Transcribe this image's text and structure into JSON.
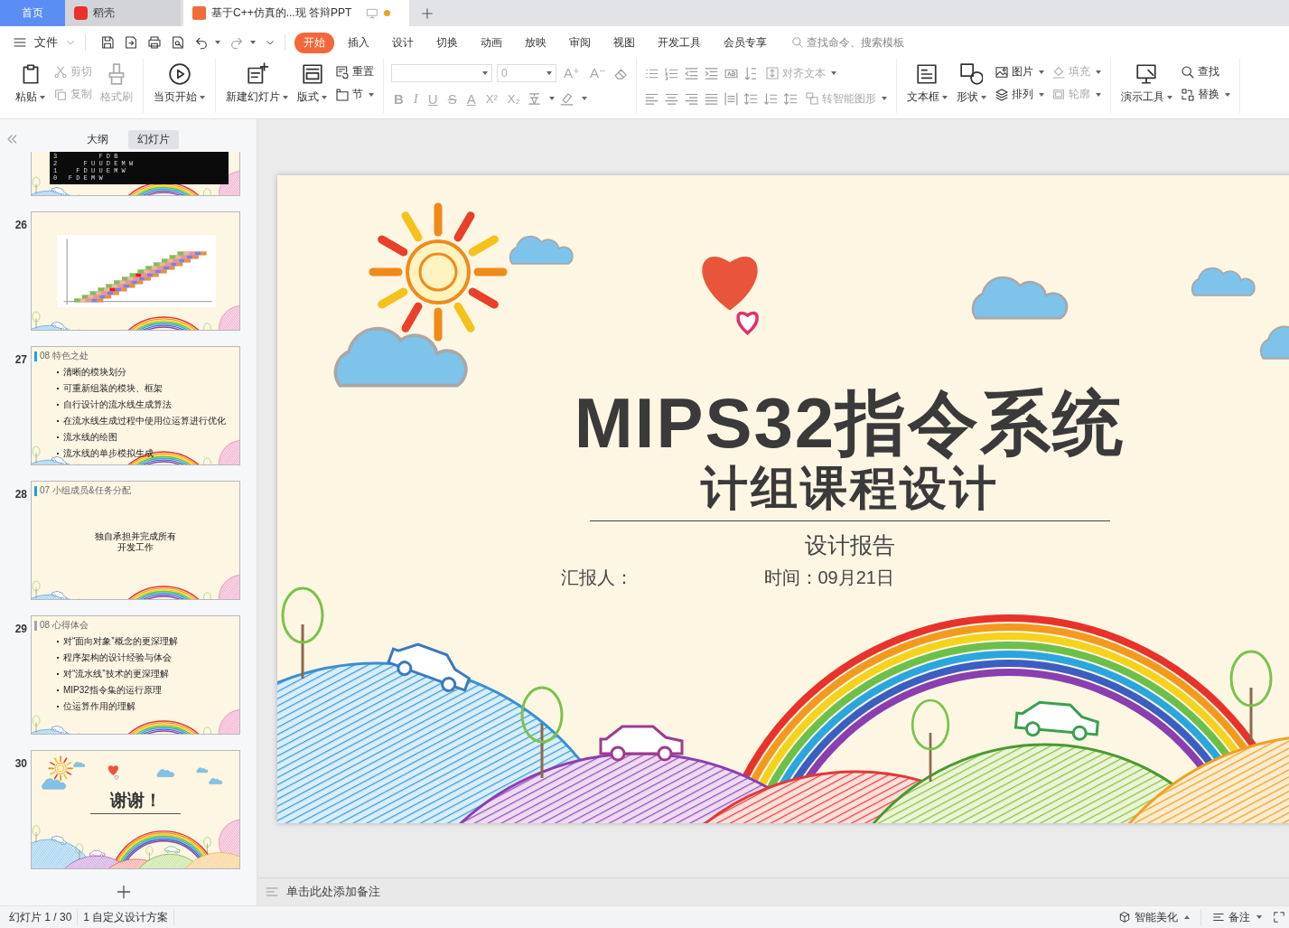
{
  "tabs": [
    {
      "label": "首页",
      "kind": "home",
      "selected": false
    },
    {
      "label": "稻壳",
      "kind": "app",
      "selected": false
    },
    {
      "label": "基于C++仿真的...现  答辩PPT",
      "kind": "doc",
      "selected": true
    }
  ],
  "menu": {
    "file": "文件",
    "ribbon_tabs": [
      {
        "label": "开始",
        "selected": true
      },
      {
        "label": "插入",
        "selected": false
      },
      {
        "label": "设计",
        "selected": false
      },
      {
        "label": "切换",
        "selected": false
      },
      {
        "label": "动画",
        "selected": false
      },
      {
        "label": "放映",
        "selected": false
      },
      {
        "label": "审阅",
        "selected": false
      },
      {
        "label": "视图",
        "selected": false
      },
      {
        "label": "开发工具",
        "selected": false
      },
      {
        "label": "会员专享",
        "selected": false
      }
    ],
    "search": {
      "placeholder": "查找命令、搜索模板"
    }
  },
  "ribbon": {
    "groups": [
      {
        "columns": [
          {
            "kind": "big",
            "label": "粘贴",
            "dropdown": true,
            "disabled": false
          },
          {
            "kind": "stack",
            "items": [
              {
                "label": "剪切",
                "dropdown": false,
                "disabled": true
              },
              {
                "label": "复制",
                "dropdown": false,
                "disabled": true
              }
            ]
          },
          {
            "kind": "big",
            "label": "格式刷",
            "dropdown": false,
            "disabled": true
          }
        ]
      },
      {
        "columns": [
          {
            "kind": "big",
            "label": "当页开始",
            "dropdown": true,
            "disabled": false
          }
        ]
      },
      {
        "columns": [
          {
            "kind": "big",
            "label": "新建幻灯片",
            "dropdown": true,
            "disabled": false
          },
          {
            "kind": "big",
            "label": "版式",
            "dropdown": true,
            "disabled": false
          },
          {
            "kind": "stack",
            "items": [
              {
                "label": "重置",
                "dropdown": false,
                "disabled": false
              },
              {
                "label": "节",
                "dropdown": true,
                "disabled": false
              }
            ]
          }
        ]
      },
      {
        "columns": [
          {
            "kind": "font",
            "size": "0",
            "size_buttons": [
              "A⁺",
              "A⁻"
            ],
            "format_buttons": [
              "B",
              "I",
              "U",
              "S",
              "A",
              "X²",
              "X₂"
            ]
          }
        ]
      },
      {
        "columns": [
          {
            "kind": "paragraph",
            "items": [
              {
                "label": "对齐文本",
                "dropdown": true,
                "disabled": true
              },
              {
                "label": "转智能图形",
                "dropdown": true,
                "disabled": true
              }
            ]
          }
        ]
      },
      {
        "columns": [
          {
            "kind": "big",
            "label": "文本框",
            "dropdown": true,
            "disabled": false
          },
          {
            "kind": "big",
            "label": "形状",
            "dropdown": true,
            "disabled": false
          },
          {
            "kind": "stack",
            "items": [
              {
                "label": "图片",
                "dropdown": true,
                "disabled": false
              },
              {
                "label": "排列",
                "dropdown": true,
                "disabled": false
              }
            ]
          },
          {
            "kind": "stack",
            "items": [
              {
                "label": "填充",
                "dropdown": true,
                "disabled": true
              },
              {
                "label": "轮廓",
                "dropdown": true,
                "disabled": true
              }
            ]
          }
        ]
      },
      {
        "columns": [
          {
            "kind": "big",
            "label": "演示工具",
            "dropdown": true,
            "disabled": false
          },
          {
            "kind": "stack",
            "items": [
              {
                "label": "查找",
                "dropdown": false,
                "disabled": false
              },
              {
                "label": "替换",
                "dropdown": true,
                "disabled": false
              }
            ]
          }
        ]
      }
    ]
  },
  "sidebar": {
    "view_tabs": [
      {
        "label": "大纲",
        "selected": false
      },
      {
        "label": "幻灯片",
        "selected": true
      }
    ],
    "slides": [
      {
        "kind": "console",
        "lines": [
          "3           F D B",
          "2       F U U D E M W",
          "1     F D U U E M W",
          "0   F D E M W"
        ]
      },
      {
        "number": "26",
        "kind": "chart"
      },
      {
        "number": "27",
        "kind": "bullets",
        "heading": "08 特色之处",
        "color": "#1aa3e8",
        "bullets": [
          "清晰的模块划分",
          "可重新组装的模块、框架",
          "自行设计的流水线生成算法",
          "在流水线生成过程中使用位运算进行优化",
          "流水线的绘图",
          "流水线的单步模拟生成"
        ]
      },
      {
        "number": "28",
        "kind": "text",
        "heading": "07 小组成员&任务分配",
        "color": "#1aa3e8",
        "lines": [
          "独自承担并完成所有",
          "开发工作"
        ]
      },
      {
        "number": "29",
        "kind": "bullets",
        "heading": "08 心得体会",
        "color": "#a0a4b4",
        "bullets": [
          "对“面向对象”概念的更深理解",
          "程序架构的设计经验与体会",
          "对“流水线”技术的更深理解",
          "MIP32指令集的运行原理",
          "位运算作用的理解"
        ]
      },
      {
        "number": "30",
        "kind": "title",
        "title": "谢谢！"
      }
    ]
  },
  "slide": {
    "title": "MIPS32指令系统",
    "subtitle": "计组课程设计",
    "report": "设计报告",
    "reporter": "汇报人：",
    "time": "时间：09月21日"
  },
  "notes": {
    "placeholder": "单击此处添加备注"
  },
  "status_bar": {
    "slide_count": "幻灯片 1 / 30",
    "theme": "1 自定义设计方案",
    "beautify": "智能美化",
    "notes": "备注"
  }
}
